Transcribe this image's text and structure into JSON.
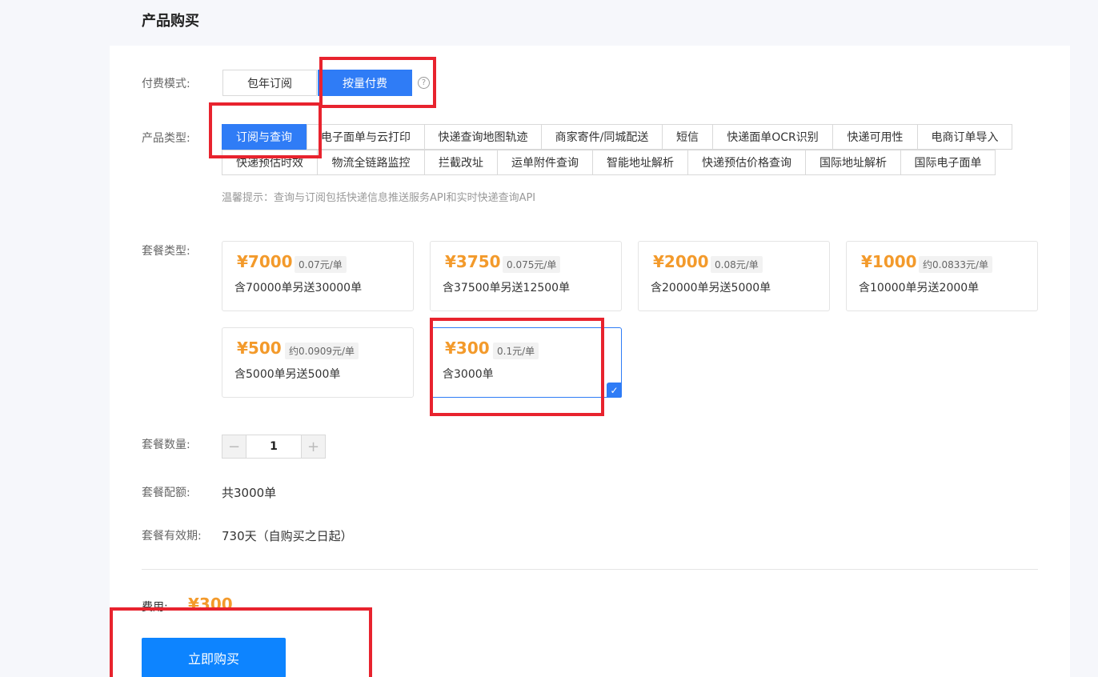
{
  "page_title": "产品购买",
  "billing": {
    "label": "付费模式:",
    "options": [
      "包年订阅",
      "按量付费"
    ],
    "help": "?"
  },
  "product_type": {
    "label": "产品类型:",
    "row1": [
      "订阅与查询",
      "电子面单与云打印",
      "快递查询地图轨迹",
      "商家寄件/同城配送",
      "短信",
      "快递面单OCR识别",
      "快递可用性",
      "电商订单导入"
    ],
    "row2": [
      "快递预估时效",
      "物流全链路监控",
      "拦截改址",
      "运单附件查询",
      "智能地址解析",
      "快递预估价格查询",
      "国际地址解析",
      "国际电子面单"
    ],
    "tip": "温馨提示：查询与订阅包括快递信息推送服务API和实时快递查询API"
  },
  "plans": {
    "label": "套餐类型:",
    "items": [
      {
        "price": "¥7000",
        "unit": "0.07元/单",
        "desc": "含70000单另送30000单"
      },
      {
        "price": "¥3750",
        "unit": "0.075元/单",
        "desc": "含37500单另送12500单"
      },
      {
        "price": "¥2000",
        "unit": "0.08元/单",
        "desc": "含20000单另送5000单"
      },
      {
        "price": "¥1000",
        "unit": "约0.0833元/单",
        "desc": "含10000单另送2000单"
      },
      {
        "price": "¥500",
        "unit": "约0.0909元/单",
        "desc": "含5000单另送500单"
      },
      {
        "price": "¥300",
        "unit": "0.1元/单",
        "desc": "含3000单"
      }
    ],
    "check": "✓"
  },
  "quantity": {
    "label": "套餐数量:",
    "minus": "−",
    "value": "1",
    "plus": "+"
  },
  "quota": {
    "label": "套餐配额:",
    "value": "共3000单"
  },
  "validity": {
    "label": "套餐有效期:",
    "value": "730天（自购买之日起）"
  },
  "fee": {
    "label": "费用:",
    "value": "¥300"
  },
  "buy_button": "立即购买",
  "colors": {
    "primary": "#2f7cf6",
    "price": "#f39a2b",
    "annotation": "#e8232e",
    "buy": "#0d84ff"
  }
}
